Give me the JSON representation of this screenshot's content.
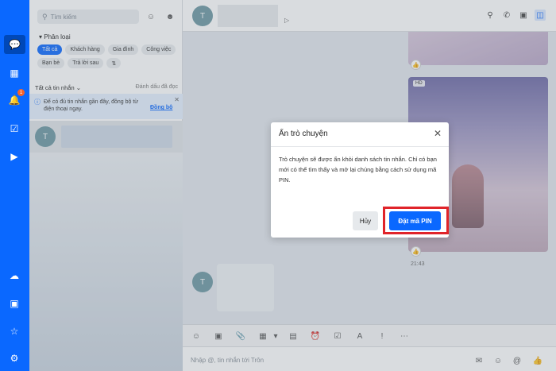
{
  "sidebar": {
    "search_placeholder": "Tìm kiếm",
    "category_title": "Phân loại",
    "chips": [
      "Tất cả",
      "Khách hàng",
      "Gia đình",
      "Công việc",
      "Bạn bè",
      "Trả lời sau"
    ],
    "all_messages": "Tất cả tin nhắn",
    "mark_read": "Đánh dấu đã đọc",
    "notice_text": "Để có đủ tin nhắn gần đây, đồng bộ từ điện thoại ngay.",
    "sync_label": "Đồng bộ",
    "conversation_initial": "T"
  },
  "rail": {
    "notification_badge": "1"
  },
  "chat": {
    "header_initial": "T",
    "hd_label": "HD",
    "time": "21:43",
    "incoming_initial": "T",
    "composer_placeholder": "Nhập @, tin nhắn tới Trôn"
  },
  "dialog": {
    "title": "Ẩn trò chuyện",
    "body": "Trò chuyện sẽ được ẩn khỏi danh sách tin nhắn. Chỉ có bạn mới có thể tìm thấy và mở lại chúng bằng cách sử dụng mã PIN.",
    "cancel_label": "Hủy",
    "confirm_label": "Đặt mã PIN"
  },
  "colors": {
    "brand": "#0a68ff",
    "highlight": "#e0242a"
  },
  "icons": {
    "rail": [
      "chat-icon",
      "contacts-icon",
      "bell-icon",
      "todo-icon",
      "video-icon",
      "cloud-icon",
      "screenshot-icon",
      "star-icon",
      "settings-icon"
    ],
    "header": [
      "search-icon",
      "phone-icon",
      "video-call-icon",
      "sidebar-toggle-icon"
    ]
  }
}
